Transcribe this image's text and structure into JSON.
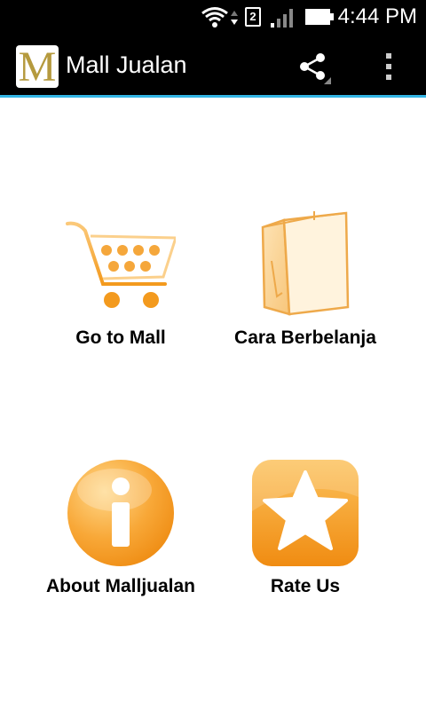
{
  "status_bar": {
    "time": "4:44 PM",
    "sim_slot": "2",
    "icons": [
      "wifi-icon",
      "sim-icon",
      "signal-icon",
      "battery-icon"
    ]
  },
  "action_bar": {
    "logo_letter": "M",
    "title": "Mall Jualan",
    "icons": [
      "share-icon",
      "overflow-menu-icon"
    ]
  },
  "menu": [
    {
      "label": "Go to Mall",
      "icon": "shopping-cart-icon"
    },
    {
      "label": "Cara Berbelanja",
      "icon": "shopping-bag-icon"
    },
    {
      "label": "About Malljualan",
      "icon": "info-icon"
    },
    {
      "label": "Rate Us",
      "icon": "star-icon"
    }
  ],
  "colors": {
    "bar_background": "#000000",
    "bar_divider": "#33b5e5",
    "accent_orange": "#f39a1e",
    "logo_gold": "#b59a3e"
  }
}
